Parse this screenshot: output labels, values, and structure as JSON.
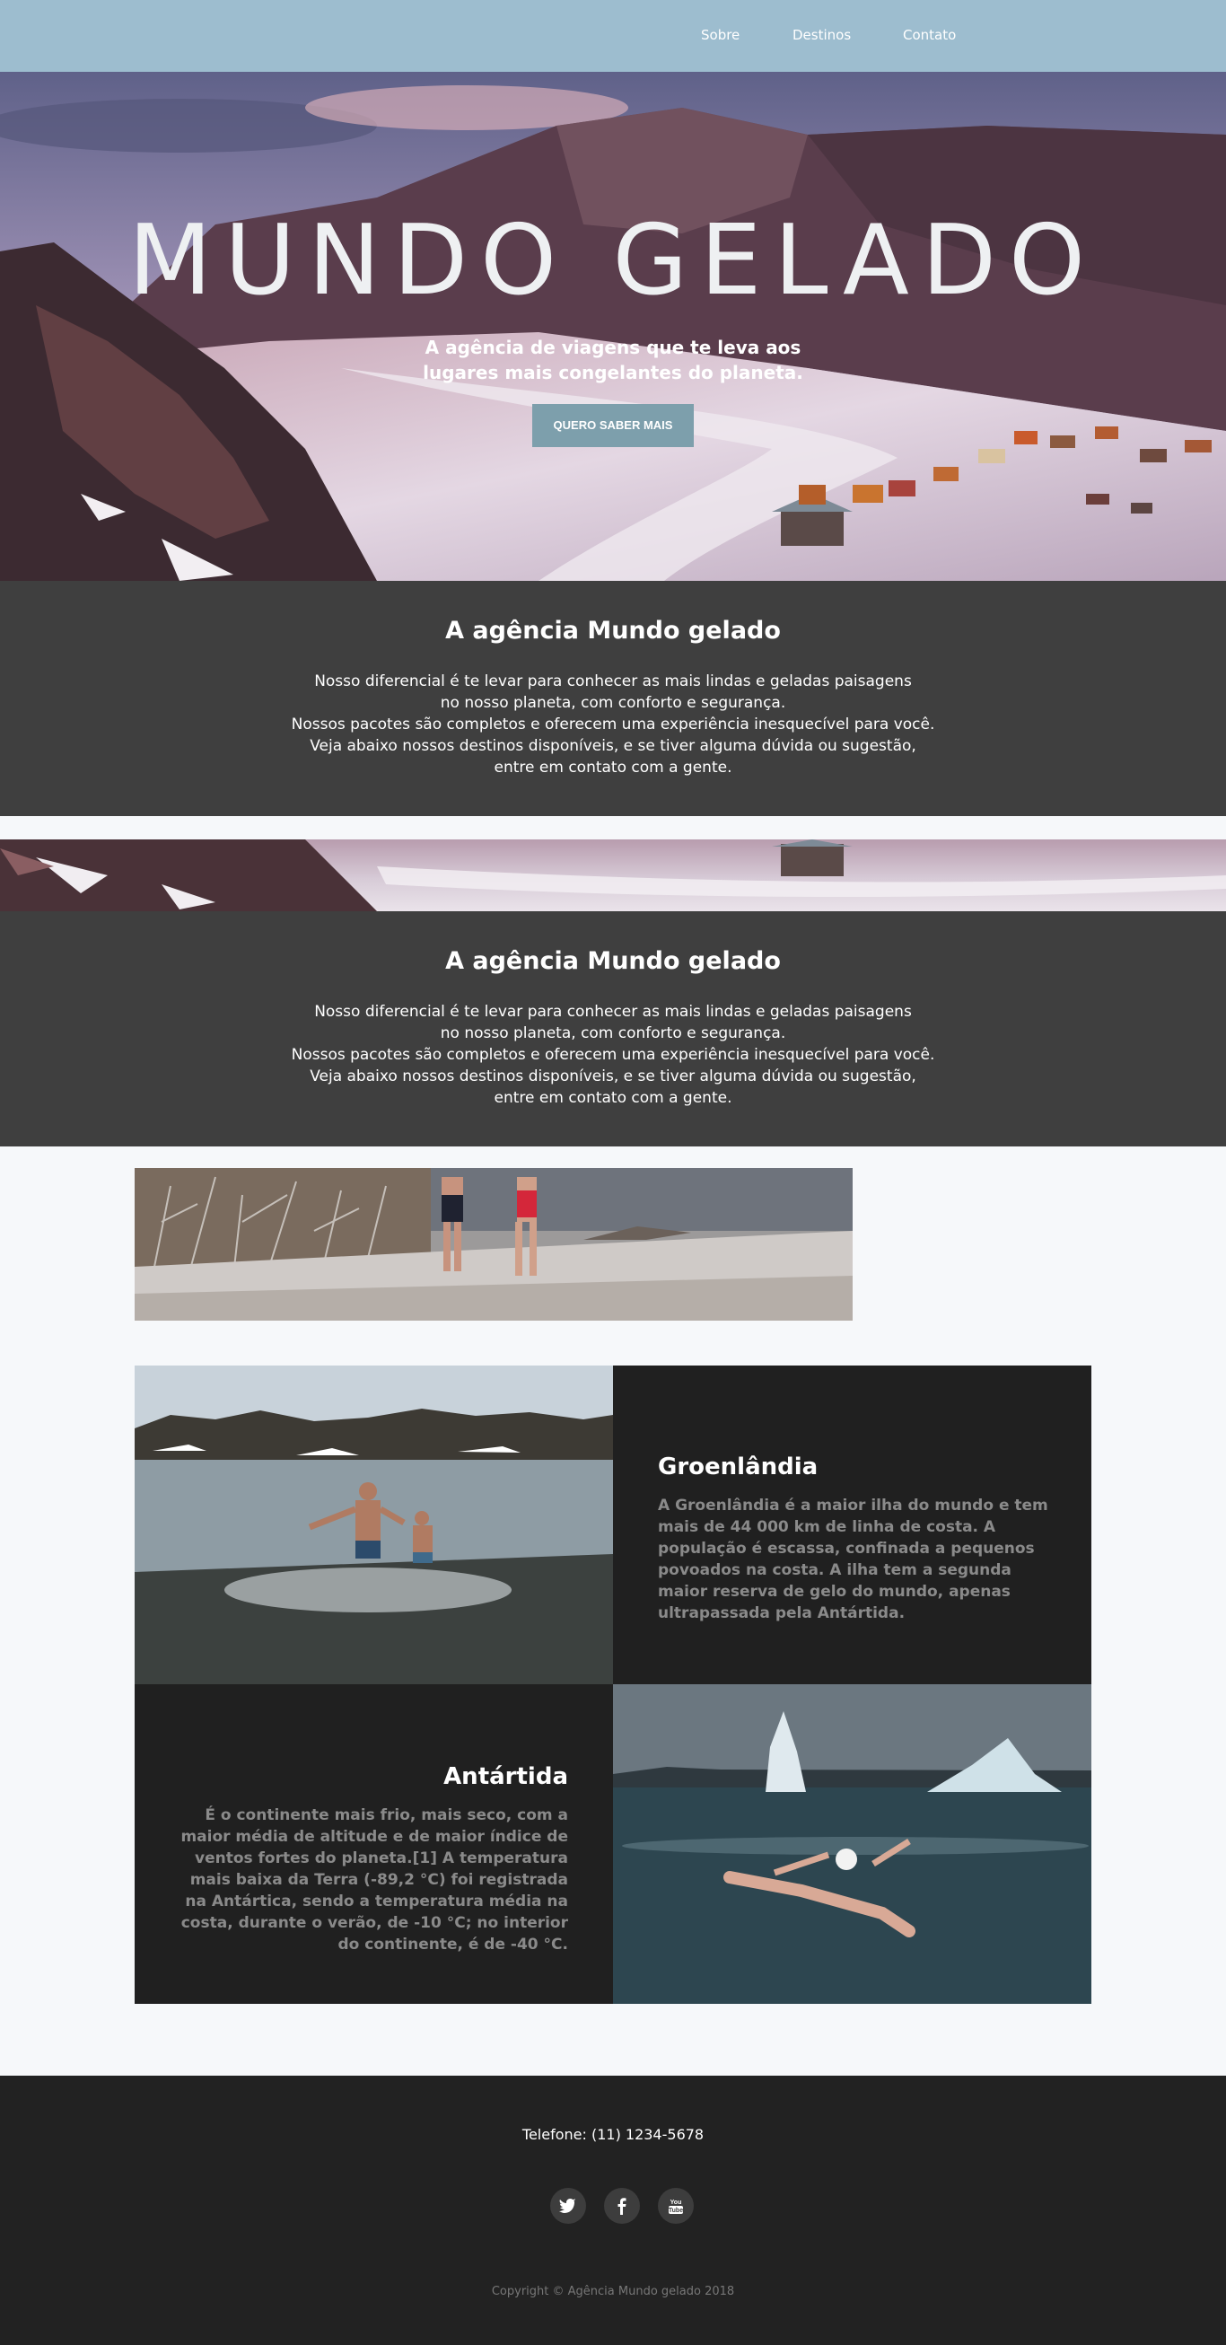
{
  "nav": {
    "links": [
      {
        "label": "Sobre"
      },
      {
        "label": "Destinos"
      },
      {
        "label": "Contato"
      }
    ]
  },
  "hero": {
    "title": "MUNDO GELADO",
    "subtitle": "A agência de viagens que te leva aos lugares mais congelantes do planeta.",
    "cta_label": "QUERO SABER MAIS"
  },
  "about": {
    "title": "A agência Mundo gelado",
    "lines": [
      "Nosso diferencial é te levar para conhecer as mais lindas e geladas paisagens",
      "no nosso planeta, com conforto e segurança.",
      "Nossos pacotes são completos e oferecem uma experiência inesquecível para você.",
      "Veja abaixo nossos destinos disponíveis, e se tiver alguma dúvida ou sugestão,",
      "entre em contato com a gente."
    ]
  },
  "about_repeat": {
    "title": "A agência Mundo gelado",
    "lines": [
      "Nosso diferencial é te levar para conhecer as mais lindas e geladas paisagens",
      "no nosso planeta, com conforto e segurança.",
      "Nossos pacotes são completos e oferecem uma experiência inesquecível para você.",
      "Veja abaixo nossos destinos disponíveis, e se tiver alguma dúvida ou sugestão,",
      "entre em contato com a gente."
    ]
  },
  "destinations": [
    {
      "title": "Groenlândia",
      "text": "A Groenlândia é a maior ilha do mundo e tem mais de 44 000 km de linha de costa. A população é escassa, confinada a pequenos povoados na costa. A ilha tem a segunda maior reserva de gelo do mundo, apenas ultrapassada pela Antártida."
    },
    {
      "title": "Antártida",
      "text": "É o continente mais frio, mais seco, com a maior média de altitude e de maior índice de ventos fortes do planeta.[1] A temperatura mais baixa da Terra (-89,2 °C) foi registrada na Antártica, sendo a temperatura média na costa, durante o verão, de -10 °C; no interior do continente, é de -40 °C."
    }
  ],
  "footer": {
    "phone": "Telefone: (11) 1234-5678",
    "social": [
      {
        "icon": "twitter-icon"
      },
      {
        "icon": "facebook-icon"
      },
      {
        "icon": "youtube-icon"
      }
    ],
    "copyright": "Copyright © Agência Mundo gelado 2018"
  },
  "colors": {
    "nav": "#9dbdcf",
    "dark_section": "#3f3f3f",
    "card_dark": "#202020",
    "footer": "#222222",
    "button": "#7d9fac"
  }
}
